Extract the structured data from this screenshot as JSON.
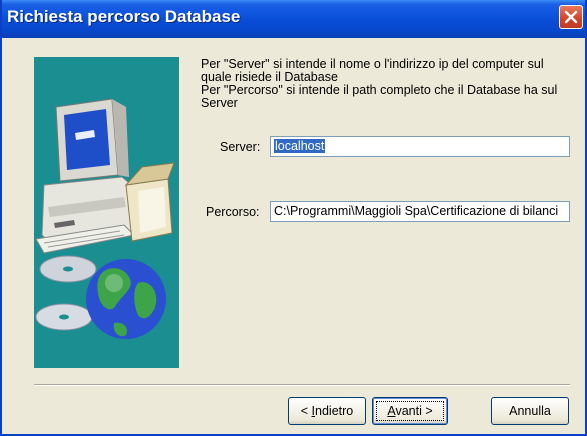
{
  "window": {
    "title": "Richiesta percorso Database",
    "close_icon": "close-icon"
  },
  "info": {
    "line1": "Per \"Server\" si intende il nome o l'indirizzo ip del computer sul",
    "line2": "quale risiede il Database",
    "line3": "Per \"Percorso\" si intende il path completo che il Database ha sul",
    "line4": "Server"
  },
  "form": {
    "server_label": "Server:",
    "server_value": "localhost",
    "path_label": "Percorso:",
    "path_value": "C:\\Programmi\\Maggioli Spa\\Certificazione di bilanci"
  },
  "buttons": {
    "back_prefix": "< ",
    "back_mnemonic": "I",
    "back_rest": "ndietro",
    "next_mnemonic": "A",
    "next_rest": "vanti >",
    "cancel": "Annulla"
  },
  "colors": {
    "banner": "#1a8e90",
    "titlebar": "#0a4fd8",
    "selection": "#316ac5"
  }
}
